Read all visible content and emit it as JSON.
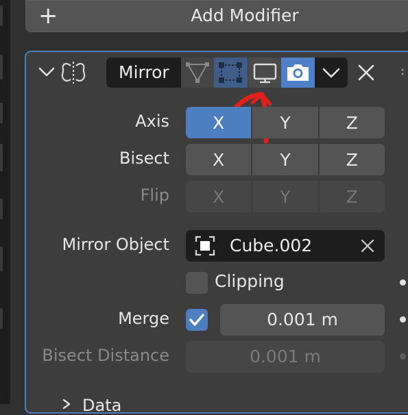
{
  "toolbar": {
    "add_modifier_label": "Add Modifier"
  },
  "modifier": {
    "name": "Mirror",
    "icons": {
      "collapse": "chevron-down-icon",
      "type": "mirror-modifier-icon",
      "edit_mode": "edit-mode-icon",
      "on_cage": "on-cage-icon",
      "viewport": "monitor-icon",
      "render": "camera-icon",
      "menu": "chevron-down-icon",
      "remove": "close-icon"
    },
    "toggles": {
      "edit_mode": false,
      "on_cage": "dimmed",
      "viewport": false,
      "render": true
    }
  },
  "axis": {
    "label": "Axis",
    "options": [
      "X",
      "Y",
      "Z"
    ],
    "active": "X"
  },
  "bisect": {
    "label": "Bisect",
    "options": [
      "X",
      "Y",
      "Z"
    ],
    "active": null
  },
  "flip": {
    "label": "Flip",
    "options": [
      "X",
      "Y",
      "Z"
    ],
    "enabled": false
  },
  "mirror_object": {
    "label": "Mirror Object",
    "value": "Cube.002"
  },
  "clipping": {
    "label": "Clipping",
    "checked": false
  },
  "merge": {
    "label": "Merge",
    "checked": true,
    "value": "0.001 m"
  },
  "bisect_distance": {
    "label": "Bisect Distance",
    "value": "0.001 m",
    "enabled": false
  },
  "subpanel": {
    "label": "Data"
  },
  "colors": {
    "accent": "#4d7ec0",
    "panel": "#3d3d3d",
    "field": "#545454",
    "dark_field": "#1d1d1d",
    "annotation": "#e0201a"
  }
}
